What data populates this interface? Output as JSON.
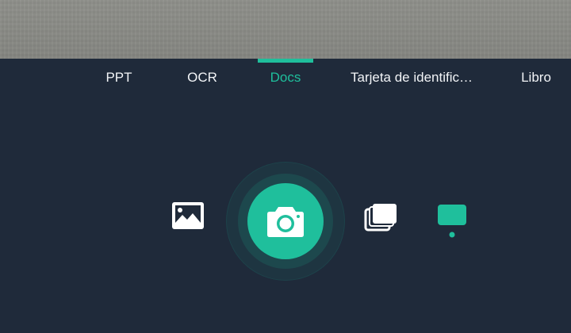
{
  "tabs": [
    {
      "label": "PPT",
      "active": false
    },
    {
      "label": "OCR",
      "active": false
    },
    {
      "label": "Docs",
      "active": true
    },
    {
      "label": "Tarjeta de identific…",
      "active": false
    },
    {
      "label": "Libro",
      "active": false
    }
  ],
  "controls": {
    "gallery_icon": "image-gallery-icon",
    "shutter_icon": "camera-icon",
    "batch_icon": "stacked-pages-icon",
    "mode_icon": "single-page-mode-icon"
  },
  "colors": {
    "background": "#1f2a3a",
    "accent": "#1fbf9c",
    "text": "#f2f4f7",
    "viewfinder": "#8a8b86"
  }
}
